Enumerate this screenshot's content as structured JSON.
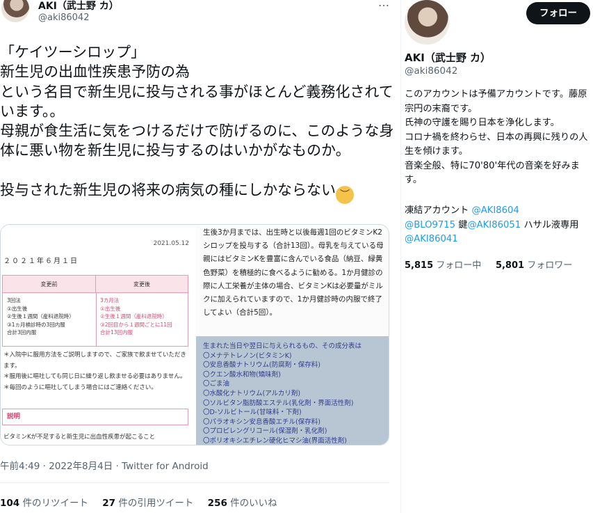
{
  "tweet": {
    "author_name": "AKI（武士野 カ）",
    "author_handle": "@aki86042",
    "more_icon": "…",
    "text": "「ケイツーシロップ」\n新生児の出血性疾患予防の為\nという名目で新生児に投与される事がほとんど義務化されています。。\n母親が食生活に気をつけるだけで防げるのに、このような身体に悪い物を新生児に投与するのはいかがなものか。\n\n投与された新生児の将来の病気の種にしかならない",
    "emoji": "pensive-face-emoji",
    "timestamp": "午前4:49 · 2022年8月4日 · Twitter for Android",
    "retweets_count": "104",
    "retweets_label": "件のリツイート",
    "quotes_count": "27",
    "quotes_label": "件の引用ツイート",
    "likes_count": "256",
    "likes_label": "件のいいね"
  },
  "media": {
    "doc_date": "2021.05.12",
    "doc_title": "２０２１年６月１日",
    "col_before": "変更前",
    "col_after": "変更後",
    "before_cell": "3回法\n①出生後\n②生後１週間（産科退院時）\n③1ヵ月検診時の3回内服\n合計3回内服",
    "after_cell": "3カ月法\n①出生後\n②生後１週間（産科退院時）\n③2回目から１週間ごとに11回\n合計13回内服",
    "notes": "＊入院中に服用方法をご説明しますので、ご家族で飲ませていただきます。\n＊服用後に嘔吐しても同じ日に繰り返し飲ませる必要はありません。\n＊毎回のように嘔吐してしまう場合にはご連絡ください。",
    "box_label": "説明",
    "bottom_line": "ビタミンKが不足すると新生児に出血性疾患が起こること",
    "right_top_text": "生後3か月までは、出生時と以後毎週1回のビタミンK2シロップを投与する（合計13回）。母乳を与えている母親にはビタミンKを豊富に含んでいる食品（納豆、緑黄色野菜）を積極的に食べるように勧める。1か月健診の際に人工栄養が主体の場合、ビタミンKは必要量がミルクに加えられていますので、1か月健診時の内服で終了してよい（合計5回）。",
    "right_bottom_text": "生まれた当日や翌日に与えられるもの、その成分表は\n〇メナテトレノン(ビタミンK)\n〇安息香酸ナトリウム(防腐剤・保存料)\n〇クエン酸水和物(矯味剤)\n〇ごま油\n〇水酸化ナトリウム(アルカリ剤)\n〇ソルビタン脂肪酸エステル(乳化剤・界面活性剤)\n〇D-ソルビトール(甘味料・下剤)\n〇パラオキシン安息香酸エチル(保存料)\n〇プロピレングリコール(保湿剤・乳化剤)\n〇ポリオキシエチレン硬化ヒマシ油(界面活性剤)\n〇香料"
  },
  "profile": {
    "follow_label": "フォロー",
    "name": "AKI（武士野 カ）",
    "handle": "@aki86042",
    "bio": "このアカウントは予備アカウントです。藤原宗円の末裔です。\n氏神の守護を賜り日本を浄化します。\nコロナ禍を終わらせ、日本の再興に残りの人生を傾けます。\n音楽全般、特に70'80'年代の音楽を好みます。",
    "frozen_label": "凍結アカウント ",
    "mention_1": "@AKI8604",
    "mention_2": "@BLO9715",
    "key_label": " 鍵",
    "mention_3": "@AKI86051",
    "dedicated_label": " ハサル液専用 ",
    "mention_4": "@AKI86041",
    "following_count": "5,815",
    "following_label": " フォロー中",
    "followers_count": "5,801",
    "followers_label": " フォロワー"
  },
  "colors": {
    "accent": "#1d9bf0",
    "text_primary": "#0f1419",
    "text_secondary": "#536471",
    "follow_button": "#0f1419",
    "doc_pink": "#e89bb0"
  }
}
